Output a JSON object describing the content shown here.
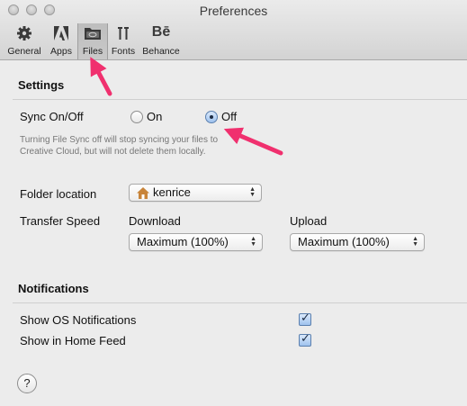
{
  "window": {
    "title": "Preferences"
  },
  "toolbar": {
    "items": [
      {
        "label": "General",
        "icon": "gear-icon"
      },
      {
        "label": "Apps",
        "icon": "adobe-icon"
      },
      {
        "label": "Files",
        "icon": "files-icon",
        "selected": true
      },
      {
        "label": "Fonts",
        "icon": "fonts-icon"
      },
      {
        "label": "Behance",
        "icon": "behance-icon"
      }
    ]
  },
  "settings": {
    "title": "Settings",
    "sync": {
      "label": "Sync On/Off",
      "on_label": "On",
      "off_label": "Off",
      "selected": "Off",
      "hint": "Turning File Sync off will stop syncing your files to Creative Cloud, but will not delete them locally."
    },
    "folder": {
      "label": "Folder location",
      "value": "kenrice"
    },
    "transfer": {
      "label": "Transfer Speed",
      "download_label": "Download",
      "download_value": "Maximum (100%)",
      "upload_label": "Upload",
      "upload_value": "Maximum (100%)"
    }
  },
  "notifications": {
    "title": "Notifications",
    "items": [
      {
        "label": "Show OS Notifications",
        "checked": true
      },
      {
        "label": "Show in Home Feed",
        "checked": true
      }
    ]
  },
  "help": {
    "label": "?"
  },
  "colors": {
    "annotation_arrow": "#f0306e",
    "accent": "#9fc2ee"
  }
}
